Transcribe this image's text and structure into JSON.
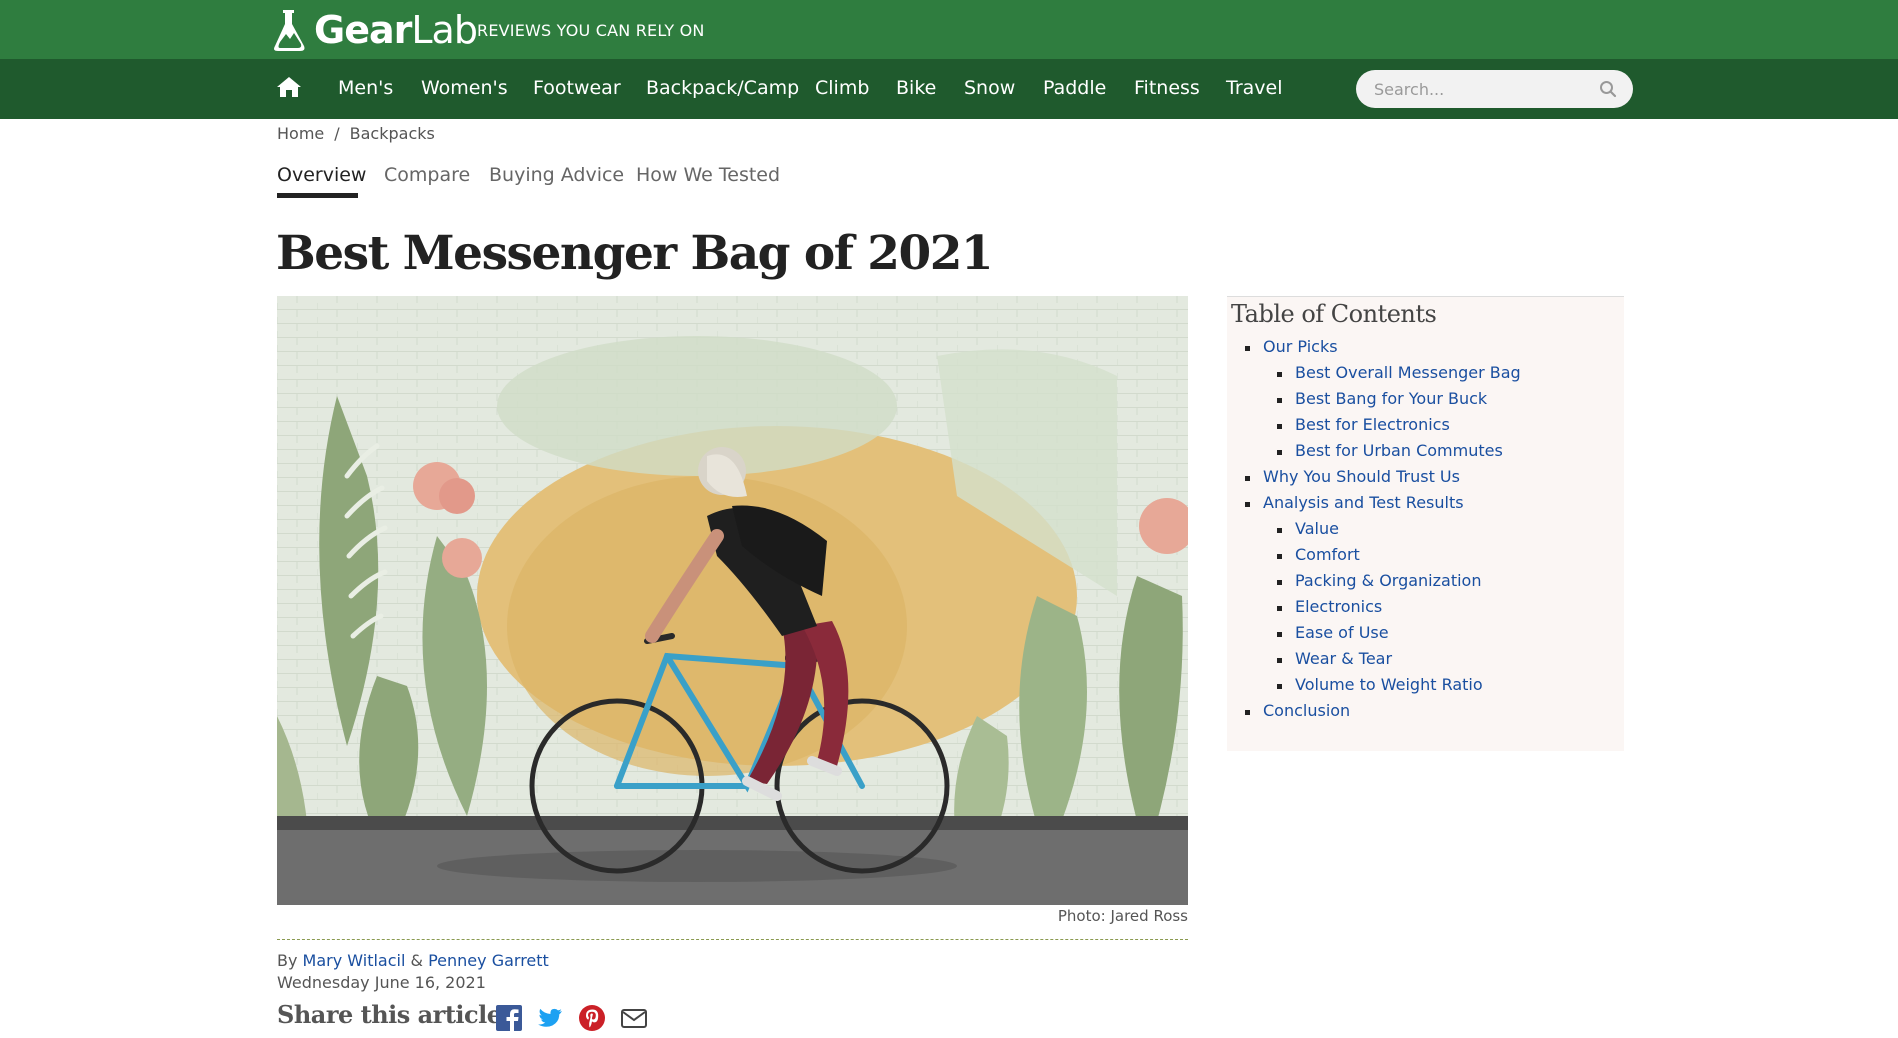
{
  "header": {
    "logo_bold": "Gear",
    "logo_light": "Lab",
    "tagline": "REVIEWS YOU CAN RELY ON"
  },
  "nav": {
    "items": [
      "Men's",
      "Women's",
      "Footwear",
      "Backpack/Camp",
      "Climb",
      "Bike",
      "Snow",
      "Paddle",
      "Fitness",
      "Travel"
    ],
    "search_placeholder": "Search..."
  },
  "breadcrumb": {
    "home": "Home",
    "separator": "/",
    "current": "Backpacks"
  },
  "tabs": [
    {
      "label": "Overview",
      "active": true
    },
    {
      "label": "Compare",
      "active": false
    },
    {
      "label": "Buying Advice",
      "active": false
    },
    {
      "label": "How We Tested",
      "active": false
    }
  ],
  "article": {
    "title": "Best Messenger Bag of 2021",
    "photo_caption": "Photo: Jared Ross",
    "by": "By",
    "author1": "Mary Witlacil",
    "and": "&",
    "author2": "Penney Garrett",
    "date": "Wednesday June 16, 2021",
    "share_label": "Share this article:"
  },
  "toc": {
    "title": "Table of Contents",
    "items": [
      {
        "label": "Our Picks",
        "level": 1
      },
      {
        "label": "Best Overall Messenger Bag",
        "level": 2
      },
      {
        "label": "Best Bang for Your Buck",
        "level": 2
      },
      {
        "label": "Best for Electronics",
        "level": 2
      },
      {
        "label": "Best for Urban Commutes",
        "level": 2
      },
      {
        "label": "Why You Should Trust Us",
        "level": 1
      },
      {
        "label": "Analysis and Test Results",
        "level": 1
      },
      {
        "label": "Value",
        "level": 2
      },
      {
        "label": "Comfort",
        "level": 2
      },
      {
        "label": "Packing & Organization",
        "level": 2
      },
      {
        "label": "Electronics",
        "level": 2
      },
      {
        "label": "Ease of Use",
        "level": 2
      },
      {
        "label": "Wear & Tear",
        "level": 2
      },
      {
        "label": "Volume to Weight Ratio",
        "level": 2
      },
      {
        "label": "Conclusion",
        "level": 1
      }
    ]
  },
  "colors": {
    "topbar": "#2f7d3f",
    "navbar": "#1f5a2d",
    "link": "#1a4fa0",
    "facebook": "#3b5998",
    "twitter": "#1da1f2",
    "pinterest": "#cb2027"
  },
  "icons": {
    "home": "home-icon",
    "search": "search-icon",
    "facebook": "facebook-icon",
    "twitter": "twitter-icon",
    "pinterest": "pinterest-icon",
    "email": "email-icon"
  }
}
